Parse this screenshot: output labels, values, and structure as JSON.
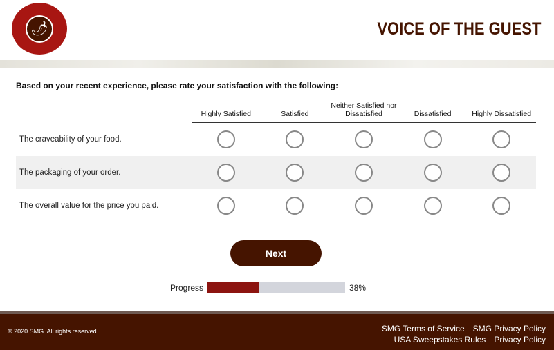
{
  "header": {
    "logo_text": "CHIPOTLE MEXICAN GRILL",
    "title": "VOICE OF THE GUEST"
  },
  "question": "Based on your recent experience, please rate your satisfaction with the following:",
  "columns": [
    "Highly Satisfied",
    "Satisfied",
    "Neither Satisfied nor Dissatisfied",
    "Dissatisfied",
    "Highly Dissatisfied"
  ],
  "rows": [
    "The craveability of your food.",
    "The packaging of your order.",
    "The overall value for the price you paid."
  ],
  "next_label": "Next",
  "progress": {
    "label": "Progress",
    "value_text": "38%",
    "percent": 38
  },
  "footer": {
    "copyright": "© 2020 SMG. All rights reserved.",
    "links": [
      "SMG Terms of Service",
      "SMG Privacy Policy",
      "USA Sweepstakes Rules",
      "Privacy Policy"
    ]
  }
}
